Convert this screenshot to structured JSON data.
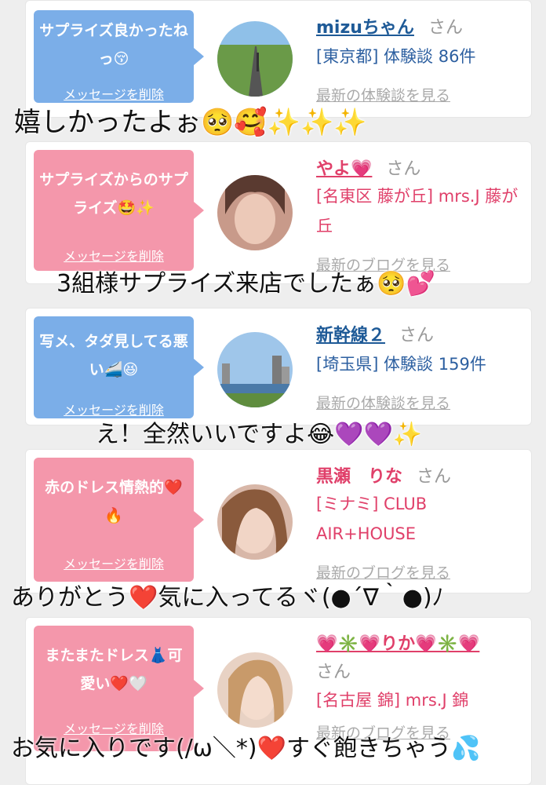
{
  "cards": [
    {
      "bubble_text": "サプライズ良かったねっ😚",
      "delete_label": "メッセージを削除",
      "name": "mizuちゃん",
      "honorific": "さん",
      "detail": "[東京都] 体験談 86件",
      "more_link": "最新の体験談を見る",
      "color": "#7baee8"
    },
    {
      "bubble_text": "サプライズからのサプライズ🤩✨",
      "delete_label": "メッセージを削除",
      "name": "やよ💗",
      "honorific": "さん",
      "detail": "[名東区 藤が丘] mrs.J 藤が丘",
      "more_link": "最新のブログを見る",
      "color": "#f497ab"
    },
    {
      "bubble_text": "写メ、タダ見してる悪い🚄😆",
      "delete_label": "メッセージを削除",
      "name": "新幹線２",
      "honorific": "さん",
      "detail": "[埼玉県] 体験談 159件",
      "more_link": "最新の体験談を見る",
      "color": "#7baee8"
    },
    {
      "bubble_text": "赤のドレス情熱的❤️🔥",
      "delete_label": "メッセージを削除",
      "name": "黒瀬　りな",
      "honorific": "さん",
      "detail": "[ミナミ] CLUB AIR+HOUSE",
      "more_link": "最新のブログを見る",
      "color": "#f497ab"
    },
    {
      "bubble_text": "またまたドレス👗可愛い❤️🤍",
      "delete_label": "メッセージを削除",
      "name": "💗✳️💗りか💗✳️💗",
      "honorific": "さん",
      "detail": "[名古屋 錦] mrs.J 錦",
      "more_link": "最新のブログを見る",
      "color": "#f497ab"
    }
  ],
  "captions": [
    "嬉しかったよぉ🥺🥰✨✨✨",
    "3組様サプライズ来店でしたぁ🥺💕",
    "え！全然いいですよ😂💜💜✨",
    "ありがとう❤️気に入ってるヾ(●´∇｀●)ﾉ",
    "お気に入りです(/ω＼*)❤️すぐ飽きちゃう💦"
  ]
}
